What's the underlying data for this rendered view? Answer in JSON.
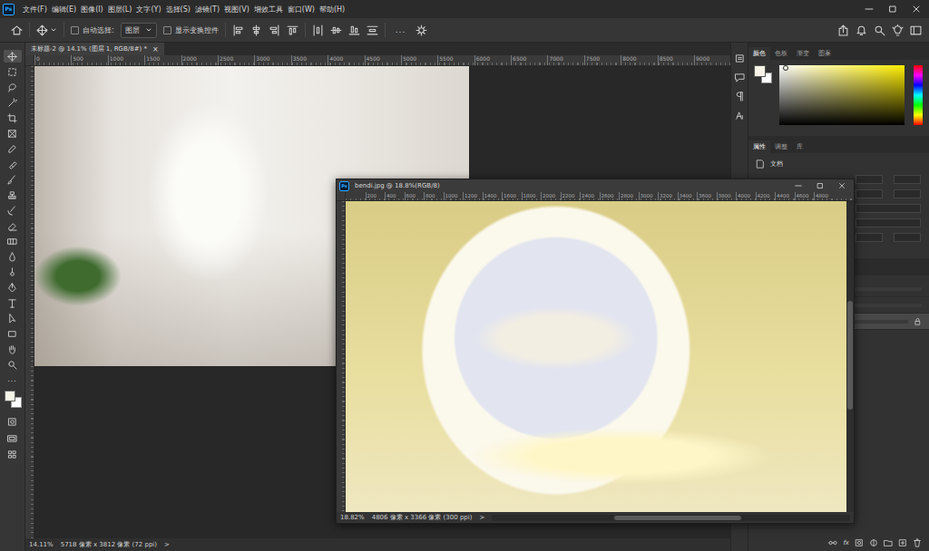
{
  "app": {
    "logo": "Ps"
  },
  "menu": [
    "文件(F)",
    "编辑(E)",
    "图像(I)",
    "图层(L)",
    "文字(Y)",
    "选择(S)",
    "滤镜(T)",
    "视图(V)",
    "增效工具",
    "窗口(W)",
    "帮助(H)"
  ],
  "options_bar": {
    "auto_select": {
      "label": "自动选择:",
      "checked": false
    },
    "target": {
      "value": "图层"
    },
    "show_transform": {
      "label": "显示变换控件",
      "checked": false
    },
    "more": "..."
  },
  "document_tab": {
    "title": "未标题-2 @ 14.1% (图层 1, RGB/8#) *",
    "close": "×",
    "selected": true
  },
  "main_ruler": {
    "ticks": [
      "0",
      "500",
      "1000",
      "1500",
      "2000",
      "2500",
      "3000",
      "3500",
      "4000",
      "4500",
      "5000",
      "5500",
      "6000",
      "6500",
      "7000",
      "7500",
      "8000",
      "8500",
      "9000"
    ]
  },
  "status_bar": {
    "zoom": "14.11%",
    "info": "5718 像素 x 3812 像素 (72 ppi)",
    "arrow": ">"
  },
  "toolbar": {
    "tools": [
      {
        "selected": true
      },
      {
        "selected": false
      },
      {
        "selected": false
      },
      {
        "selected": false
      },
      {
        "selected": false
      },
      {
        "selected": false
      },
      {
        "selected": false
      },
      {
        "selected": false
      },
      {
        "selected": false
      },
      {
        "selected": false
      },
      {
        "selected": false
      },
      {
        "selected": false
      },
      {
        "selected": false
      },
      {
        "selected": false
      },
      {
        "selected": false
      },
      {
        "selected": false
      },
      {
        "selected": false
      },
      {
        "selected": false
      },
      {
        "selected": false
      },
      {
        "selected": false
      },
      {
        "selected": false
      }
    ],
    "more": "..."
  },
  "floating_window": {
    "title": "bendi.jpg @ 18.8%(RGB/8)",
    "ruler_ticks": [
      "200",
      "400",
      "600",
      "800",
      "1000",
      "1200",
      "1400",
      "1600",
      "1800",
      "2000",
      "2200",
      "2400",
      "2600",
      "2800",
      "3000",
      "3200",
      "3400",
      "3600",
      "3800",
      "4000",
      "4200",
      "4400",
      "4600",
      "4800"
    ],
    "zoom": "18.82%",
    "info": "4806 像素 x 3366 像素 (300 ppi)",
    "arrow": ">"
  },
  "color_panel": {
    "tabs": [
      {
        "label": "颜色",
        "selected": true
      },
      {
        "label": "色板",
        "selected": false
      },
      {
        "label": "渐变",
        "selected": false
      },
      {
        "label": "图案",
        "selected": false
      }
    ]
  },
  "properties_panel": {
    "tabs": [
      {
        "label": "属性",
        "selected": true
      },
      {
        "label": "调整",
        "selected": false
      },
      {
        "label": "库",
        "selected": false
      }
    ],
    "item": "文档"
  },
  "layers_panel": {
    "rows": [
      {
        "locked": false,
        "selected": false
      },
      {
        "locked": false,
        "selected": false
      },
      {
        "locked": true,
        "selected": true
      }
    ],
    "fx": "fx"
  }
}
